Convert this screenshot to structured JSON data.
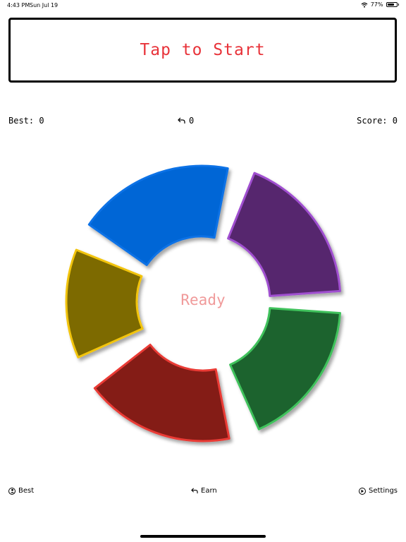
{
  "status": {
    "time": "4:43 PM",
    "date": "Sun Jul 19",
    "battery": "77%",
    "battery_level": 0.77
  },
  "start_button": {
    "label": "Tap to Start"
  },
  "stats": {
    "best_label": "Best:",
    "best_value": "0",
    "undo_value": "0",
    "score_label": "Score:",
    "score_value": "0"
  },
  "wheel": {
    "center_text": "Ready",
    "center_color": "#f09a9a",
    "segments": [
      {
        "name": "blue",
        "fill": "#0266d6",
        "stroke": "#0a72e6"
      },
      {
        "name": "purple",
        "fill": "#57286e",
        "stroke": "#a050d0"
      },
      {
        "name": "green",
        "fill": "#1c632e",
        "stroke": "#3fc25c"
      },
      {
        "name": "red",
        "fill": "#841d19",
        "stroke": "#ea3a34"
      },
      {
        "name": "yellow",
        "fill": "#7d6a00",
        "stroke": "#f2c40a"
      }
    ]
  },
  "bottom": {
    "best_label": "Best",
    "earn_label": "Earn",
    "settings_label": "Settings"
  },
  "colors": {
    "accent": "#e8333a"
  }
}
